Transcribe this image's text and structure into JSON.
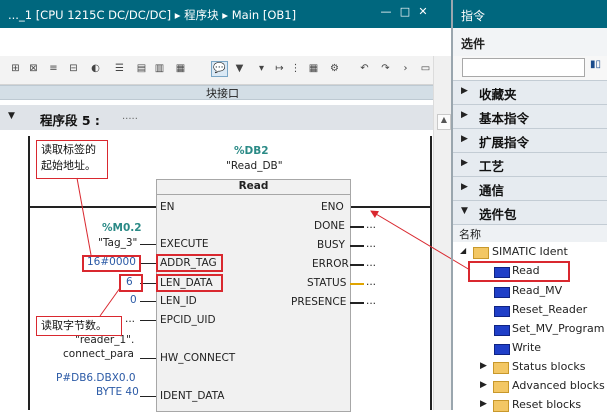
{
  "window": {
    "title": "..._1 [CPU 1215C DC/DC/DC] ▸ 程序块 ▸ Main [OB1]",
    "minimize": "—",
    "restore": "□",
    "close": "✕"
  },
  "editor": {
    "interface_label": "块接口",
    "segment_label": "程序段 5 :",
    "segment_comment": ".....",
    "block_instance": "%DB2",
    "block_instance_name": "\"Read_DB\"",
    "block_type": "Read",
    "inputs": [
      "EN",
      "EXECUTE",
      "ADDR_TAG",
      "LEN_DATA",
      "LEN_ID",
      "EPCID_UID",
      "HW_CONNECT",
      "IDENT_DATA"
    ],
    "outputs": [
      "ENO",
      "DONE",
      "BUSY",
      "ERROR",
      "STATUS",
      "PRESENCE"
    ],
    "output_dots": "...",
    "execute_addr": "%M0.2",
    "execute_tag": "\"Tag_3\"",
    "addr_tag_value": "16#0000",
    "len_data_value": "6",
    "len_id_value": "0",
    "epcid_value": "...",
    "hw_connect_line1": "\"reader_1\".",
    "hw_connect_line2": "connect_para",
    "ident_line1": "P#DB6.DBX0.0",
    "ident_line2": "BYTE 40"
  },
  "annotations": {
    "callout_top": [
      "读取标签的",
      "起始地址。"
    ],
    "callout_bottom": "读取字节数。"
  },
  "instructions_pane": {
    "title": "指令",
    "options_label": "选件",
    "search_value": "",
    "categories": [
      {
        "label": "收藏夹",
        "expanded": false
      },
      {
        "label": "基本指令",
        "expanded": false
      },
      {
        "label": "扩展指令",
        "expanded": false
      },
      {
        "label": "工艺",
        "expanded": false
      },
      {
        "label": "通信",
        "expanded": false
      },
      {
        "label": "选件包",
        "expanded": true
      }
    ],
    "name_header": "名称",
    "tree": {
      "folder": "SIMATIC Ident",
      "items": [
        "Read",
        "Read_MV",
        "Reset_Reader",
        "Set_MV_Program",
        "Write"
      ],
      "subfolders": [
        "Status blocks",
        "Advanced blocks",
        "Reset blocks"
      ]
    }
  },
  "colors": {
    "titlebar": "#00677e",
    "highlight_red": "#d9282f",
    "instance_teal": "#2a8a86",
    "param_blue": "#2b5aa6"
  }
}
